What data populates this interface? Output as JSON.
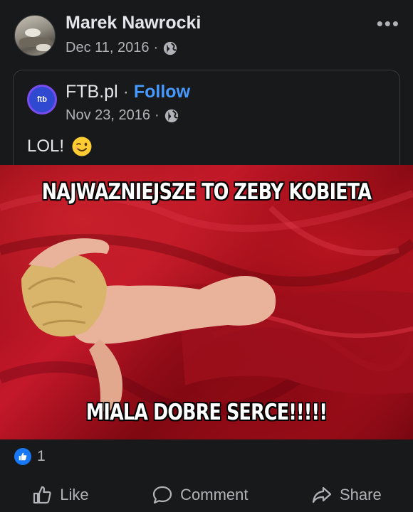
{
  "post": {
    "author_name": "Marek Nawrocki",
    "date": "Dec 11, 2016",
    "separator": "·",
    "privacy_icon": "globe-icon",
    "more_icon": "more-options-icon"
  },
  "shared_post": {
    "page_name": "FTB.pl",
    "page_avatar_text": "ftb",
    "separator": "·",
    "follow_label": "Follow",
    "date": "Nov 23, 2016",
    "privacy_icon": "globe-icon",
    "text": "LOL!",
    "emoji": "wink-emoji"
  },
  "meme": {
    "caption_top": "NAJWAZNIEJSZE TO ZEBY KOBIETA",
    "caption_bottom": "MIALA DOBRE SERCE!!!!!"
  },
  "reactions": {
    "icon": "like-reaction-icon",
    "count": "1"
  },
  "actions": {
    "like_label": "Like",
    "comment_label": "Comment",
    "share_label": "Share"
  },
  "colors": {
    "background": "#18191a",
    "primary_text": "#e4e6eb",
    "secondary_text": "#b0b3b8",
    "follow_link": "#4599ff",
    "like_badge": "#1877f2"
  }
}
